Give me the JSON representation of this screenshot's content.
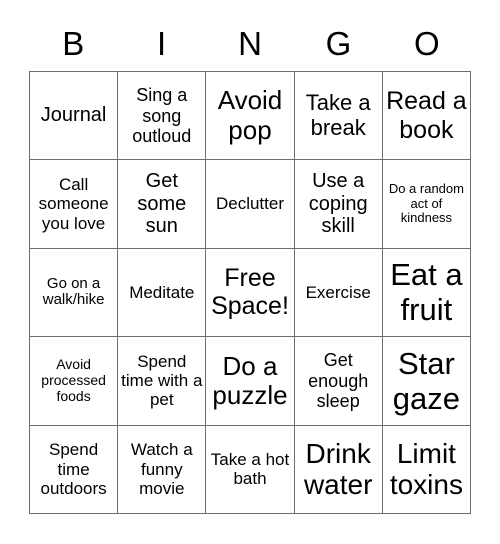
{
  "card": {
    "title_letters": [
      "B",
      "I",
      "N",
      "G",
      "O"
    ],
    "rows": [
      [
        {
          "text": "Journal",
          "size": "fs-20"
        },
        {
          "text": "Sing a song outloud",
          "size": "fs-18"
        },
        {
          "text": "Avoid pop",
          "size": "fs-26"
        },
        {
          "text": "Take a break",
          "size": "fs-22"
        },
        {
          "text": "Read a book",
          "size": "fs-25"
        }
      ],
      [
        {
          "text": "Call someone you love",
          "size": "fs-17"
        },
        {
          "text": "Get some sun",
          "size": "fs-20"
        },
        {
          "text": "Declutter",
          "size": "fs-17"
        },
        {
          "text": "Use a coping skill",
          "size": "fs-20"
        },
        {
          "text": "Do a random act of kindness",
          "size": "fs-13"
        }
      ],
      [
        {
          "text": "Go on a walk/hike",
          "size": "fs-15"
        },
        {
          "text": "Meditate",
          "size": "fs-17"
        },
        {
          "text": "Free Space!",
          "size": "fs-25"
        },
        {
          "text": "Exercise",
          "size": "fs-17"
        },
        {
          "text": "Eat a fruit",
          "size": "fs-31"
        }
      ],
      [
        {
          "text": "Avoid processed foods",
          "size": "fs-14"
        },
        {
          "text": "Spend time with a pet",
          "size": "fs-17"
        },
        {
          "text": "Do a puzzle",
          "size": "fs-26"
        },
        {
          "text": "Get enough sleep",
          "size": "fs-18"
        },
        {
          "text": "Star gaze",
          "size": "fs-31"
        }
      ],
      [
        {
          "text": "Spend time outdoors",
          "size": "fs-17"
        },
        {
          "text": "Watch a funny movie",
          "size": "fs-17"
        },
        {
          "text": "Take a hot bath",
          "size": "fs-17"
        },
        {
          "text": "Drink water",
          "size": "fs-28"
        },
        {
          "text": "Limit toxins",
          "size": "fs-28"
        }
      ]
    ],
    "colors": {
      "background": "#ffffff",
      "text": "#000000",
      "grid_line": "#6e6e6e"
    }
  }
}
